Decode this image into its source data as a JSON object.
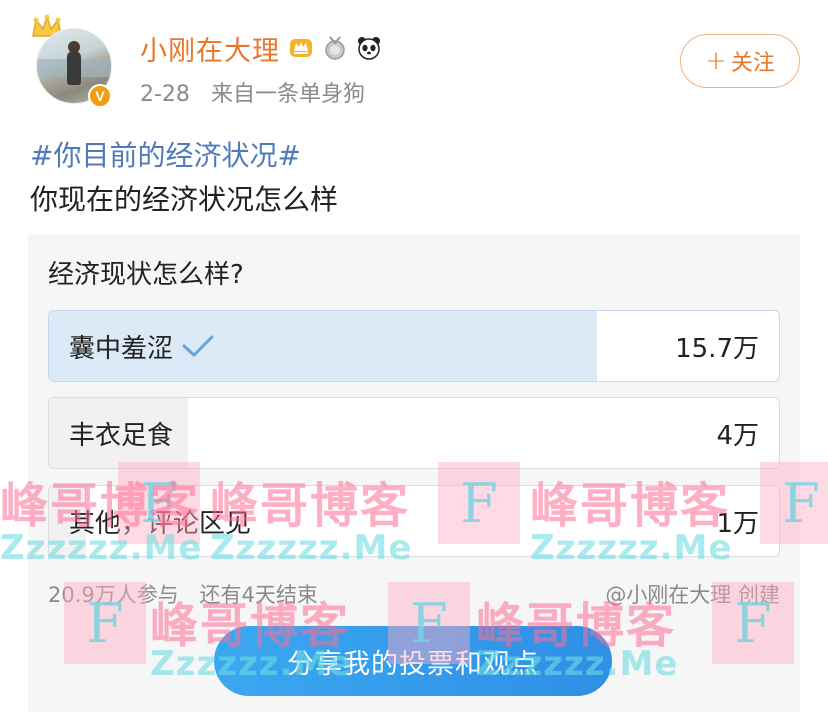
{
  "post": {
    "username": "小刚在大理",
    "date": "2-28",
    "source": "来自一条单身狗",
    "follow_label": "关注",
    "follow_plus": "+",
    "hashtag": "#你目前的经济状况#",
    "text": "你现在的经济状况怎么样",
    "badges": [
      "crown-badge-icon",
      "medal-badge-icon",
      "panda-icon"
    ],
    "verified_icon": "V"
  },
  "poll": {
    "question": "经济现状怎么样?",
    "options": [
      {
        "label": "囊中羞涩",
        "count": "15.7万",
        "share": 0.75,
        "selected": true
      },
      {
        "label": "丰衣足食",
        "count": "4万",
        "share": 0.19,
        "selected": false
      },
      {
        "label": "其他，评论区见",
        "count": "1万",
        "share": 0.05,
        "selected": false
      }
    ],
    "participants": "20.9万人参与",
    "remaining": "还有4天结束",
    "creator": "@小刚在大理 创建",
    "share_label": "分享我的投票和观点"
  },
  "watermark": {
    "cn": "峰哥博客",
    "en": "Zzzzzz.Me",
    "letter": "F"
  },
  "colors": {
    "username": "#e8762b",
    "hashtag": "#4f7cb8",
    "selected_fill": "#dce9f7",
    "unselected_fill": "#f1f1f1",
    "share_button": "#2f8fe6"
  }
}
